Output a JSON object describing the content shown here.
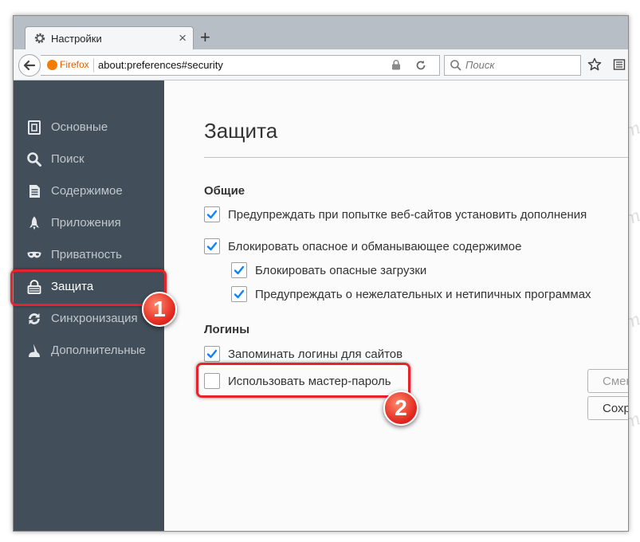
{
  "browser": {
    "tab_title": "Настройки",
    "tab_close": "×",
    "new_tab": "+",
    "identity_label": "Firefox",
    "url": "about:preferences#security",
    "search_placeholder": "Поиск"
  },
  "sidebar": {
    "items": [
      {
        "label": "Основные",
        "icon": "general-icon",
        "active": false
      },
      {
        "label": "Поиск",
        "icon": "search-icon",
        "active": false
      },
      {
        "label": "Содержимое",
        "icon": "content-icon",
        "active": false
      },
      {
        "label": "Приложения",
        "icon": "applications-icon",
        "active": false
      },
      {
        "label": "Приватность",
        "icon": "privacy-mask-icon",
        "active": false
      },
      {
        "label": "Защита",
        "icon": "lock-icon",
        "active": true
      },
      {
        "label": "Синхронизация",
        "icon": "sync-icon",
        "active": false
      },
      {
        "label": "Дополнительные",
        "icon": "advanced-icon",
        "active": false
      }
    ]
  },
  "content": {
    "title": "Защита",
    "general": {
      "heading": "Общие",
      "options": [
        {
          "label": "Предупреждать при попытке веб-сайтов установить дополнения",
          "checked": true
        },
        {
          "label": "Блокировать опасное и обманывающее содержимое",
          "checked": true
        },
        {
          "label": "Блокировать опасные загрузки",
          "checked": true
        },
        {
          "label": "Предупреждать о нежелательных и нетипичных программах",
          "checked": true
        }
      ]
    },
    "logins": {
      "heading": "Логины",
      "options": [
        {
          "label": "Запоминать логины для сайтов",
          "checked": true
        },
        {
          "label": "Использовать мастер-пароль",
          "checked": false
        }
      ],
      "buttons": [
        {
          "label": "Смени",
          "enabled": false
        },
        {
          "label": "Сохр",
          "enabled": true
        }
      ]
    }
  },
  "annotations": {
    "badge_1": "1",
    "badge_2": "2",
    "color": "#e8232c"
  },
  "watermark": "Soringpcrepair.com",
  "colors": {
    "sidebar_bg": "#424f5a",
    "checkmark": "#0a84ff",
    "content_bg": "#fbfbfb"
  }
}
